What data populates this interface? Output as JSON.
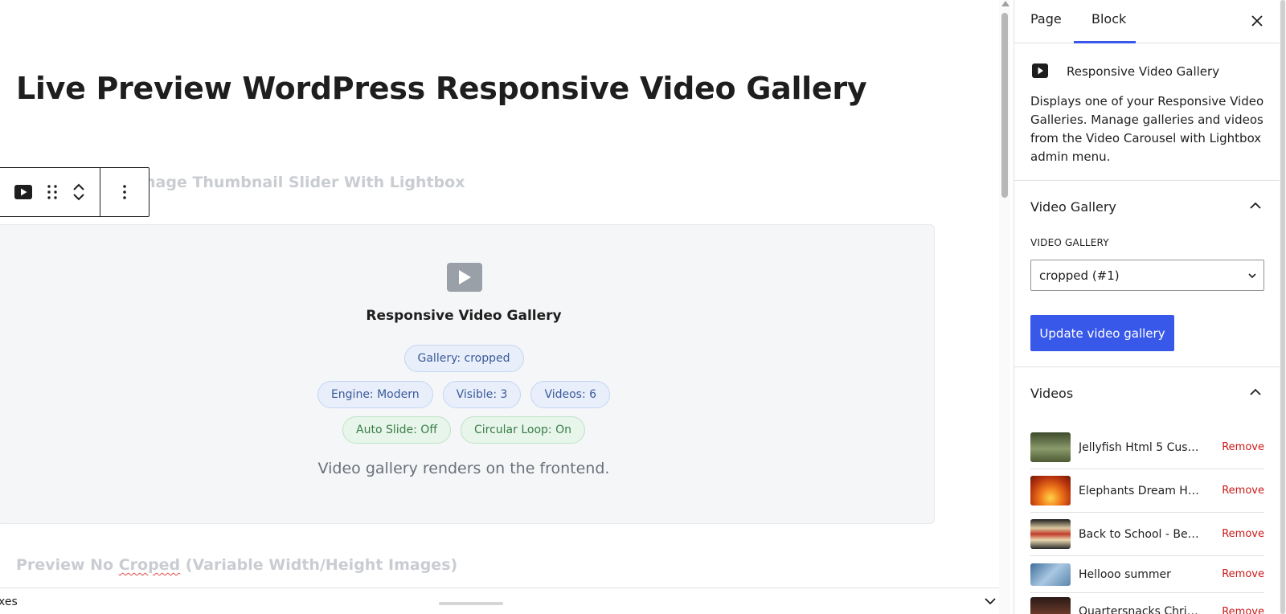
{
  "editor": {
    "title": "Live Preview WordPress Responsive Video Gallery",
    "faded_heading": "Image Thumbnail Slider With Lightbox",
    "faded_heading_visible": "nage Thumbnail Slider With Lightbox",
    "faded_heading_2_prefix": "Preview No ",
    "faded_heading_2_squiggle": "Croped",
    "faded_heading_2_suffix": " (Variable Width/Height Images)"
  },
  "block_toolbar": {
    "block_icon": "play-icon",
    "drag_icon": "drag-handle-icon",
    "move_up_icon": "chevron-up-icon",
    "move_down_icon": "chevron-down-icon",
    "options_icon": "more-vertical-icon"
  },
  "preview": {
    "icon": "play-icon",
    "title": "Responsive Video Gallery",
    "gallery_pill": "Gallery: cropped",
    "pills_row2": [
      "Engine: Modern",
      "Visible: 3",
      "Videos: 6"
    ],
    "pills_row3": [
      "Auto Slide: Off",
      "Circular Loop: On"
    ],
    "note": "Video gallery renders on the frontend."
  },
  "bottom_bar": {
    "label": "xes"
  },
  "sidebar": {
    "tabs": [
      "Page",
      "Block"
    ],
    "active_tab": "Block",
    "block_name": "Responsive Video Gallery",
    "block_description": "Displays one of your Responsive Video Galleries. Manage galleries and videos from the Video Carousel with Lightbox admin menu.",
    "gallery_panel": {
      "title": "Video Gallery",
      "field_label": "VIDEO GALLERY",
      "selected": "cropped (#1)",
      "button": "Update video gallery"
    },
    "videos_panel": {
      "title": "Videos",
      "remove_label": "Remove",
      "items": [
        {
          "title": "Jellyfish Html 5 Cust...",
          "thumb_color": "#6b7a4e"
        },
        {
          "title": "Elephants Dream Ht...",
          "thumb_color": "#e8611a"
        },
        {
          "title": "Back to School - Best...",
          "thumb_color": "#b89a5c"
        },
        {
          "title": "Hellooo summer",
          "thumb_color": "#7fa3c4"
        },
        {
          "title": "Quartersnacks Christ...",
          "thumb_color": "#4a2b24"
        }
      ]
    }
  },
  "colors": {
    "accent": "#3858e9",
    "remove": "#cc1818",
    "pill_blue": "#e8effb",
    "pill_green": "#e7f5ea"
  }
}
